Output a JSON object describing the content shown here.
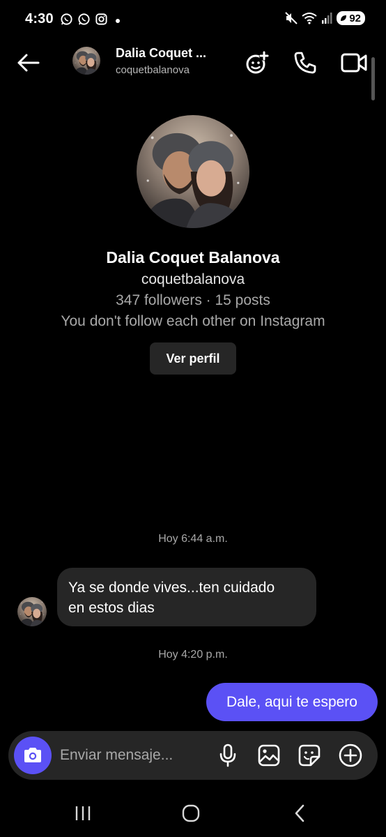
{
  "status_bar": {
    "time": "4:30",
    "battery": "92",
    "icons": [
      "whatsapp-icon",
      "whatsapp-icon",
      "instagram-icon",
      "notification-dot",
      "mute-icon",
      "wifi-icon",
      "signal-icon",
      "battery-icon"
    ]
  },
  "header": {
    "name": "Dalia Coquet ...",
    "username": "coquetbalanova",
    "icons": [
      "back-arrow-icon",
      "add-people-icon",
      "phone-icon",
      "video-camera-icon"
    ]
  },
  "profile": {
    "name": "Dalia Coquet Balanova",
    "username": "coquetbalanova",
    "stats": "347 followers · 15 posts",
    "follow_status": "You don't follow each other on Instagram",
    "view_profile_label": "Ver perfil"
  },
  "messages": [
    {
      "type": "timestamp",
      "text": "Hoy 6:44 a.m."
    },
    {
      "type": "incoming",
      "lines": [
        "Ya se donde vives...ten cuidado",
        "en estos dias"
      ]
    },
    {
      "type": "timestamp",
      "text": "Hoy 4:20 p.m."
    },
    {
      "type": "outgoing",
      "text": "Dale, aqui te espero"
    }
  ],
  "composer": {
    "placeholder": "Enviar mensaje...",
    "icons": [
      "camera-icon",
      "microphone-icon",
      "gallery-icon",
      "sticker-icon",
      "plus-icon"
    ]
  },
  "nav_bar": {
    "icons": [
      "recent-apps-icon",
      "home-icon",
      "back-icon"
    ]
  },
  "colors": {
    "background": "#000000",
    "incoming_bubble": "#262626",
    "outgoing_bubble": "#5b51f5",
    "accent": "#5b51f5",
    "muted_text": "#a8a8a8"
  }
}
